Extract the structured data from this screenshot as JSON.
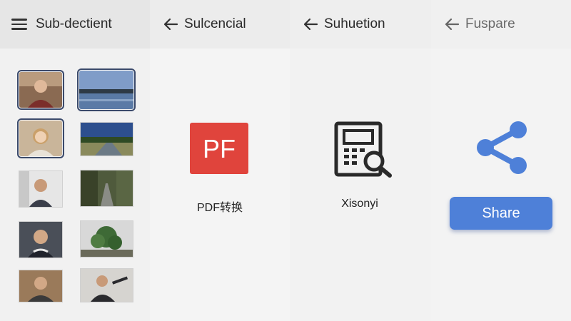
{
  "panels": [
    {
      "title": "Sub-dectient",
      "icon": "menu-icon"
    },
    {
      "title": "Sulcencial",
      "icon": "back-arrow-icon"
    },
    {
      "title": "Suhuetion",
      "icon": "back-arrow-icon"
    },
    {
      "title": "Fuspare",
      "icon": "back-arrow-icon"
    }
  ],
  "gallery": {
    "thumbnails": [
      {
        "subject": "man-portrait",
        "selected": true
      },
      {
        "subject": "lake-landscape",
        "selected": true
      },
      {
        "subject": "woman-portrait",
        "selected": true
      },
      {
        "subject": "river-landscape",
        "selected": false
      },
      {
        "subject": "man-portrait",
        "selected": false
      },
      {
        "subject": "road-trees",
        "selected": false
      },
      {
        "subject": "man-portrait",
        "selected": false
      },
      {
        "subject": "tree-foliage",
        "selected": false
      },
      {
        "subject": "man-portrait",
        "selected": false
      },
      {
        "subject": "man-portrait",
        "selected": false
      }
    ]
  },
  "apps": {
    "pdf": {
      "icon_text": "PF",
      "label": "PDF转换",
      "color": "#e0443c",
      "icon": "pdf-app-icon"
    },
    "scanner": {
      "label": "Xisonyi",
      "icon": "document-search-icon"
    },
    "share": {
      "icon": "share-icon",
      "button_label": "Share",
      "color": "#4e80d8"
    }
  }
}
